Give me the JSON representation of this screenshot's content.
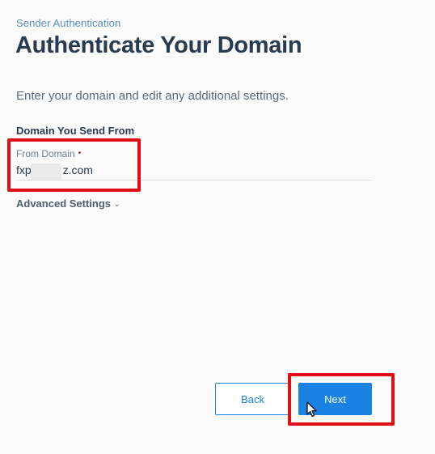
{
  "header": {
    "breadcrumb": "Sender Authentication",
    "title": "Authenticate Your Domain"
  },
  "main": {
    "subtitle": "Enter your domain and edit any additional settings.",
    "section_label": "Domain You Send From",
    "from_domain": {
      "label": "From Domain",
      "required_marker": "•",
      "value_prefix": "fxp",
      "value_suffix": "z.com"
    },
    "advanced_settings": {
      "label": "Advanced Settings",
      "icon": "chevron-down-icon",
      "chevron": "⌄"
    }
  },
  "footer": {
    "back_label": "Back",
    "next_label": "Next"
  },
  "colors": {
    "accent": "#1a82e2",
    "title": "#293b4f",
    "highlight": "#e10d17",
    "required": "#d0021b"
  }
}
